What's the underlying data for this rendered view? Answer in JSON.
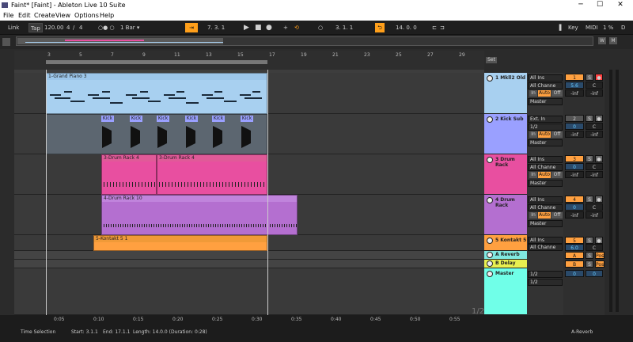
{
  "window": {
    "title": "Faint* [Faint] - Ableton Live 10 Suite",
    "min": "─",
    "max": "☐",
    "close": "✕"
  },
  "menu": [
    "File",
    "Edit",
    "Create",
    "View",
    "Options",
    "Help"
  ],
  "toolbar": {
    "link": "Link",
    "tap": "Tap",
    "tempo": "120.00",
    "sig_num": "4",
    "sig_den": "4",
    "metro": "○● ○",
    "quant": "1 Bar ▾",
    "position": "7.  3.  1",
    "loop_start": "3.  1.  1",
    "loop_len": "14.  0.  0",
    "key": "Key",
    "midi": "MIDI",
    "cpu": "1 %",
    "disk": "D"
  },
  "ruler": [
    "3",
    "5",
    "7",
    "9",
    "11",
    "13",
    "15",
    "17",
    "19",
    "21",
    "23",
    "25",
    "27",
    "29"
  ],
  "time_axis": [
    "0:05",
    "0:10",
    "0:15",
    "0:20",
    "0:25",
    "0:30",
    "0:35",
    "0:40",
    "0:45",
    "0:50",
    "0:55"
  ],
  "tracks": [
    {
      "name": "1 Mkll2 Old",
      "color": "#a8d0f0",
      "input": "All Ins",
      "channel": "All Channe",
      "monitor": [
        "In",
        "Auto",
        "Off"
      ],
      "output": "Master",
      "number": "1",
      "volume": "5.6",
      "pan": "C",
      "meter_l": "-inf",
      "meter_r": "-inf",
      "clip": "1-Grand Piano 3"
    },
    {
      "name": "2 Kick Sub",
      "color": "#9aa0ff",
      "input": "Ext. In",
      "channel": "1/2",
      "monitor": [
        "In",
        "Auto",
        "Off"
      ],
      "output": "Master",
      "number": "2",
      "volume": "0",
      "pan": "C",
      "meter_l": "-inf",
      "meter_r": "-inf",
      "clip": "Kick"
    },
    {
      "name": "3 Drum Rack",
      "color": "#e84fa0",
      "input": "All Ins",
      "channel": "All Channe",
      "monitor": [
        "In",
        "Auto",
        "Off"
      ],
      "output": "Master",
      "number": "3",
      "volume": "0",
      "pan": "C",
      "meter_l": "-inf",
      "meter_r": "-inf",
      "clip": "3-Drum Rack 4"
    },
    {
      "name": "4 Drum Rack",
      "color": "#b46fd0",
      "input": "All Ins",
      "channel": "All Channe",
      "monitor": [
        "In",
        "Auto",
        "Off"
      ],
      "output": "Master",
      "number": "4",
      "volume": "0",
      "pan": "C",
      "meter_l": "-inf",
      "meter_r": "-inf",
      "clip": "4-Drum Rack 10"
    },
    {
      "name": "5 Kontakt 5",
      "color": "#ffa040",
      "input": "All Ins",
      "channel": "All Channe",
      "number": "5",
      "volume": "6.0",
      "pan": "C",
      "clip": "5-Kontakt 5 1"
    },
    {
      "name": "A Reverb",
      "color": "#80e8e0",
      "number": "A",
      "post": "Post"
    },
    {
      "name": "B Delay",
      "color": "#e8f050",
      "number": "B",
      "post": "Post"
    },
    {
      "name": "Master",
      "color": "#70ffe8",
      "channel_a": "1/2",
      "channel_b": "1/2",
      "volume": "0",
      "pan": "0"
    }
  ],
  "set_label": "Set",
  "status": {
    "selection": "Time Selection",
    "start": "Start: 3.1.1",
    "end": "End: 17.1.1",
    "length": "Length: 14.0.0  (Duration: 0:28)",
    "device": "A-Reverb",
    "page": "1/2"
  }
}
